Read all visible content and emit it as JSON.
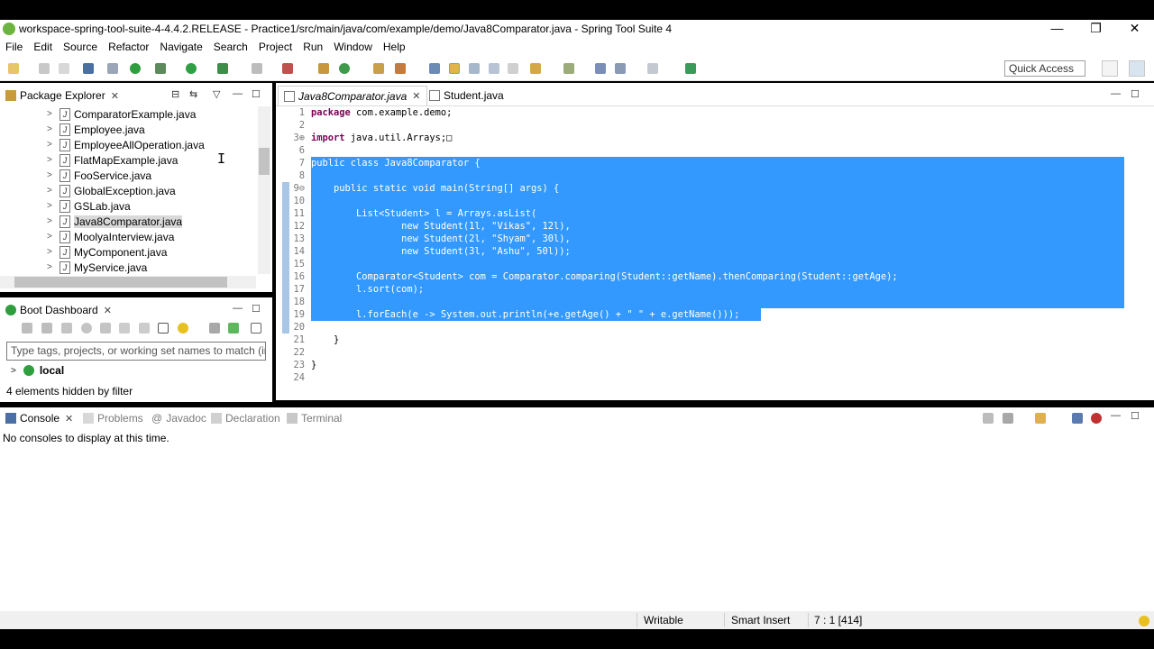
{
  "window": {
    "title": "workspace-spring-tool-suite-4-4.4.2.RELEASE - Practice1/src/main/java/com/example/demo/Java8Comparator.java - Spring Tool Suite 4",
    "minimize": "—",
    "restore": "❐",
    "close": "✕"
  },
  "menu": [
    "File",
    "Edit",
    "Source",
    "Refactor",
    "Navigate",
    "Search",
    "Project",
    "Run",
    "Window",
    "Help"
  ],
  "toolbar": {
    "quick_access": "Quick Access"
  },
  "package_explorer": {
    "title": "Package Explorer",
    "items": [
      "ComparatorExample.java",
      "Employee.java",
      "EmployeeAllOperation.java",
      "FlatMapExample.java",
      "FooService.java",
      "GlobalException.java",
      "GSLab.java",
      "Java8Comparator.java",
      "MoolyaInterview.java",
      "MyComponent.java",
      "MyService.java"
    ],
    "selected_index": 7
  },
  "boot_dashboard": {
    "title": "Boot Dashboard",
    "filter_placeholder": "Type tags, projects, or working set names to match (incl.",
    "local_label": "local",
    "hidden_text": "4 elements hidden by filter"
  },
  "editor": {
    "tabs": [
      "Java8Comparator.java",
      "Student.java"
    ],
    "active_tab": 0,
    "line_numbers": [
      "1",
      "2",
      "3⊕",
      "6",
      "7",
      "8",
      "9⊖",
      "10",
      "11",
      "12",
      "13",
      "14",
      "15",
      "16",
      "17",
      "18",
      "19",
      "20",
      "21",
      "22",
      "23",
      "24"
    ],
    "lines": [
      "package com.example.demo;",
      "",
      "import java.util.Arrays;□",
      "",
      "public class Java8Comparator {",
      "",
      "    public static void main(String[] args) {",
      "",
      "        List<Student> l = Arrays.asList(",
      "                new Student(1l, \"Vikas\", 12l),",
      "                new Student(2l, \"Shyam\", 30l),",
      "                new Student(3l, \"Ashu\", 50l));",
      "",
      "        Comparator<Student> com = Comparator.comparing(Student::getName).thenComparing(Student::getAge);",
      "        l.sort(com);",
      "",
      "        l.forEach(e -> System.out.println(+e.getAge() + \" \" + e.getName()));",
      "",
      "    }",
      "",
      "}",
      ""
    ]
  },
  "bottom_panel": {
    "tabs": [
      "Console",
      "Problems",
      "Javadoc",
      "Declaration",
      "Terminal"
    ],
    "message": "No consoles to display at this time."
  },
  "status": {
    "writable": "Writable",
    "insert_mode": "Smart Insert",
    "position": "7 : 1 [414]"
  },
  "colors": {
    "selection": "#3399ff",
    "keyword": "#7f0055",
    "string": "#2a00ff",
    "spring_green": "#6db33f"
  }
}
